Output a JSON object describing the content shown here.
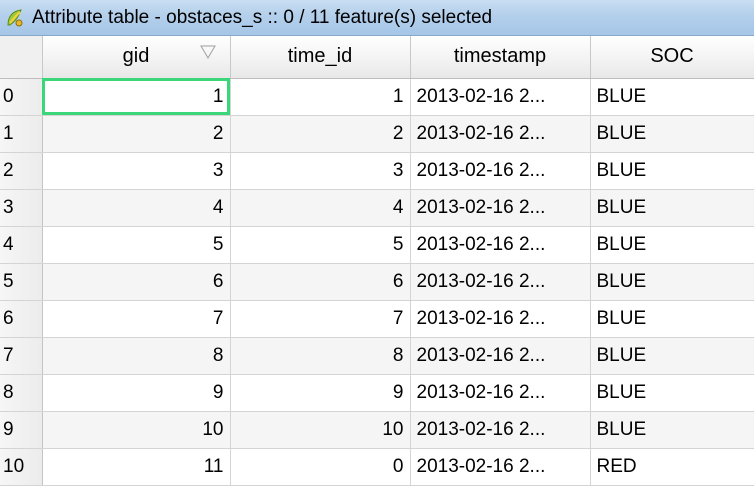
{
  "window": {
    "title": "Attribute table - obstaces_s :: 0 / 11 feature(s) selected",
    "icon": "qgis-icon"
  },
  "table": {
    "columns": [
      "gid",
      "time_id",
      "timestamp",
      "SOC"
    ],
    "sorted_column": "gid",
    "selected_cell": {
      "row": 0,
      "column": "gid"
    },
    "rows": [
      {
        "index": "0",
        "gid": "1",
        "time_id": "1",
        "timestamp": "2013-02-16 2...",
        "SOC": "BLUE"
      },
      {
        "index": "1",
        "gid": "2",
        "time_id": "2",
        "timestamp": "2013-02-16 2...",
        "SOC": "BLUE"
      },
      {
        "index": "2",
        "gid": "3",
        "time_id": "3",
        "timestamp": "2013-02-16 2...",
        "SOC": "BLUE"
      },
      {
        "index": "3",
        "gid": "4",
        "time_id": "4",
        "timestamp": "2013-02-16 2...",
        "SOC": "BLUE"
      },
      {
        "index": "4",
        "gid": "5",
        "time_id": "5",
        "timestamp": "2013-02-16 2...",
        "SOC": "BLUE"
      },
      {
        "index": "5",
        "gid": "6",
        "time_id": "6",
        "timestamp": "2013-02-16 2...",
        "SOC": "BLUE"
      },
      {
        "index": "6",
        "gid": "7",
        "time_id": "7",
        "timestamp": "2013-02-16 2...",
        "SOC": "BLUE"
      },
      {
        "index": "7",
        "gid": "8",
        "time_id": "8",
        "timestamp": "2013-02-16 2...",
        "SOC": "BLUE"
      },
      {
        "index": "8",
        "gid": "9",
        "time_id": "9",
        "timestamp": "2013-02-16 2...",
        "SOC": "BLUE"
      },
      {
        "index": "9",
        "gid": "10",
        "time_id": "10",
        "timestamp": "2013-02-16 2...",
        "SOC": "BLUE"
      },
      {
        "index": "10",
        "gid": "11",
        "time_id": "0",
        "timestamp": "2013-02-16 2...",
        "SOC": "RED"
      }
    ]
  },
  "colors": {
    "titlebar": "#b3cfeb",
    "selection_outline": "#3bd67a",
    "grid_line": "#d4d4d4",
    "alt_row": "#f5f5f5"
  }
}
